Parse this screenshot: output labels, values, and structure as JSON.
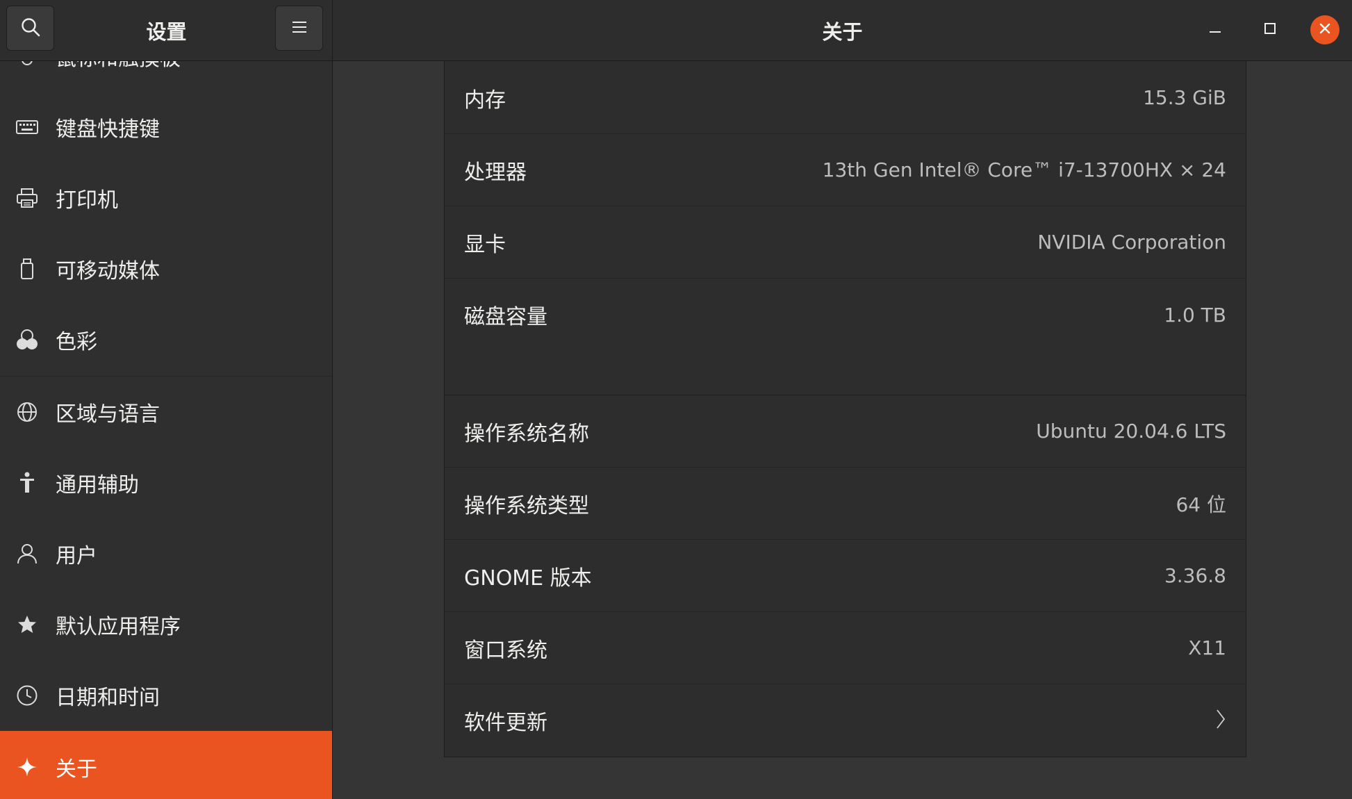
{
  "header": {
    "sidebar_title": "设置",
    "page_title": "关于"
  },
  "sidebar": {
    "items": [
      {
        "label": "鼠标和触摸板",
        "icon": "mouse-icon"
      },
      {
        "label": "键盘快捷键",
        "icon": "keyboard-icon"
      },
      {
        "label": "打印机",
        "icon": "printer-icon"
      },
      {
        "label": "可移动媒体",
        "icon": "removable-media-icon"
      },
      {
        "label": "色彩",
        "icon": "color-icon"
      },
      {
        "label": "区域与语言",
        "icon": "globe-icon"
      },
      {
        "label": "通用辅助",
        "icon": "accessibility-icon"
      },
      {
        "label": "用户",
        "icon": "user-icon"
      },
      {
        "label": "默认应用程序",
        "icon": "star-icon"
      },
      {
        "label": "日期和时间",
        "icon": "clock-icon"
      },
      {
        "label": "关于",
        "icon": "sparkle-icon",
        "selected": true
      }
    ]
  },
  "hardware": [
    {
      "label": "内存",
      "value": "15.3 GiB"
    },
    {
      "label": "处理器",
      "value": "13th Gen Intel® Core™ i7-13700HX × 24"
    },
    {
      "label": "显卡",
      "value": "NVIDIA Corporation"
    },
    {
      "label": "磁盘容量",
      "value": "1.0 TB"
    }
  ],
  "software": [
    {
      "label": "操作系统名称",
      "value": "Ubuntu 20.04.6 LTS"
    },
    {
      "label": "操作系统类型",
      "value": "64 位"
    },
    {
      "label": "GNOME 版本",
      "value": "3.36.8"
    },
    {
      "label": "窗口系统",
      "value": "X11"
    },
    {
      "label": "软件更新",
      "value": ""
    }
  ],
  "colors": {
    "accent": "#e95420",
    "sidebar_bg": "#2f2f2f",
    "content_bg": "#353535",
    "card_bg": "#2d2d2d"
  }
}
